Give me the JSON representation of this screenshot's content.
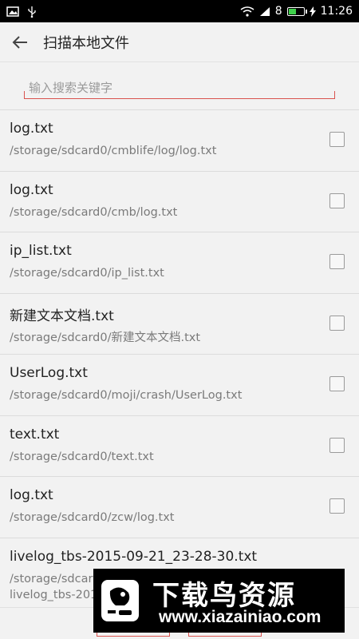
{
  "status_bar": {
    "signal": "8",
    "time": "11:26",
    "battery_level": 0.55,
    "battery_color": "#3fd14b"
  },
  "app_bar": {
    "title": "扫描本地文件",
    "back_icon": "arrow-left-icon"
  },
  "search": {
    "placeholder": "输入搜索关键字",
    "underline_color": "#d9534f"
  },
  "files": [
    {
      "name": "log.txt",
      "path": "/storage/sdcard0/cmblife/log/log.txt"
    },
    {
      "name": "log.txt",
      "path": "/storage/sdcard0/cmb/log.txt"
    },
    {
      "name": "ip_list.txt",
      "path": "/storage/sdcard0/ip_list.txt"
    },
    {
      "name": "新建文本文档.txt",
      "path": "/storage/sdcard0/新建文本文档.txt"
    },
    {
      "name": "UserLog.txt",
      "path": "/storage/sdcard0/moji/crash/UserLog.txt"
    },
    {
      "name": "text.txt",
      "path": "/storage/sdcard0/text.txt"
    },
    {
      "name": "log.txt",
      "path": "/storage/sdcard0/zcw/log.txt"
    },
    {
      "name": "livelog_tbs-2015-09-21_23-28-30.txt",
      "path": "/storage/sdcard0/",
      "path2": "livelog_tbs-2015"
    }
  ],
  "watermark": {
    "title": "下载鸟资源",
    "url": "www.xiazainiao.com"
  }
}
